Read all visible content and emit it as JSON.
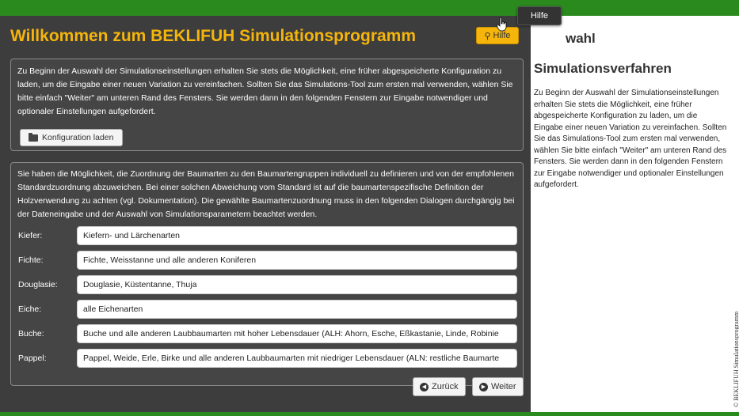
{
  "header": {
    "title": "Willkommen zum BEKLIFUH Simulationsprogramm",
    "help_label": "Hilfe",
    "help_tooltip": "Hilfe"
  },
  "intro_box": {
    "text": "Zu Beginn der Auswahl der Simulationseinstellungen erhalten Sie stets die Möglichkeit, eine früher abgespeicherte Konfiguration zu laden, um die Eingabe einer neuen Variation zu vereinfachen. Sollten Sie das Simulations-Tool zum ersten mal verwenden, wählen Sie bitte einfach \"Weiter\" am unteren Rand des Fensters. Sie werden dann in den folgenden Fenstern zur Eingabe notwendiger und optionaler Einstellungen aufgefordert.",
    "load_button_label": "Konfiguration laden"
  },
  "species_box": {
    "text": "Sie haben die Möglichkeit, die Zuordnung der Baumarten zu den Baumartengruppen individuell zu definieren und von der empfohlenen Standardzuordnung abzuweichen. Bei einer solchen Abweichung vom Standard ist auf die baumartenspezifische Definition der Holzverwendung zu achten (vgl. Dokumentation). Die gewählte Baumartenzuordnung muss in den folgenden Dialogen durchgängig bei der Dateneingabe und der Auswahl von Simulationsparametern beachtet werden.",
    "rows": [
      {
        "label": "Kiefer:",
        "value": "Kiefern- und Lärchenarten"
      },
      {
        "label": "Fichte:",
        "value": "Fichte, Weisstanne und alle anderen Koniferen"
      },
      {
        "label": "Douglasie:",
        "value": "Douglasie, Küstentanne, Thuja"
      },
      {
        "label": "Eiche:",
        "value": "alle Eichenarten"
      },
      {
        "label": "Buche:",
        "value": "Buche und alle anderen Laubbaumarten mit hoher Lebensdauer (ALH: Ahorn, Esche, Eßkastanie, Linde, Robinie"
      },
      {
        "label": "Pappel:",
        "value": "Pappel, Weide, Erle, Birke und alle anderen Laubbaumarten mit niedriger Lebensdauer (ALN: restliche Baumarte"
      }
    ]
  },
  "navigation": {
    "back_label": "Zurück",
    "next_label": "Weiter"
  },
  "help_panel": {
    "heading_partial": "wahl",
    "heading2": "Simulationsverfahren",
    "text": "Zu Beginn der Auswahl der Simulationseinstellungen erhalten Sie stets die Möglichkeit, eine früher abgespeicherte Konfiguration zu laden, um die Eingabe einer neuen Variation zu vereinfachen. Sollten Sie das Simulations-Tool zum ersten mal verwenden, wählen Sie bitte einfach \"Weiter\" am unteren Rand des Fensters. Sie werden dann in den folgenden Fenstern zur Eingabe notwendiger und optionaler Einstellungen aufgefordert."
  },
  "side_strip": {
    "text": "© BEKLIFUH Simulationsprogramm"
  },
  "colors": {
    "accent": "#f5b50a",
    "top_bar": "#2b8a1e",
    "panel_bg": "#3d3d3d"
  }
}
